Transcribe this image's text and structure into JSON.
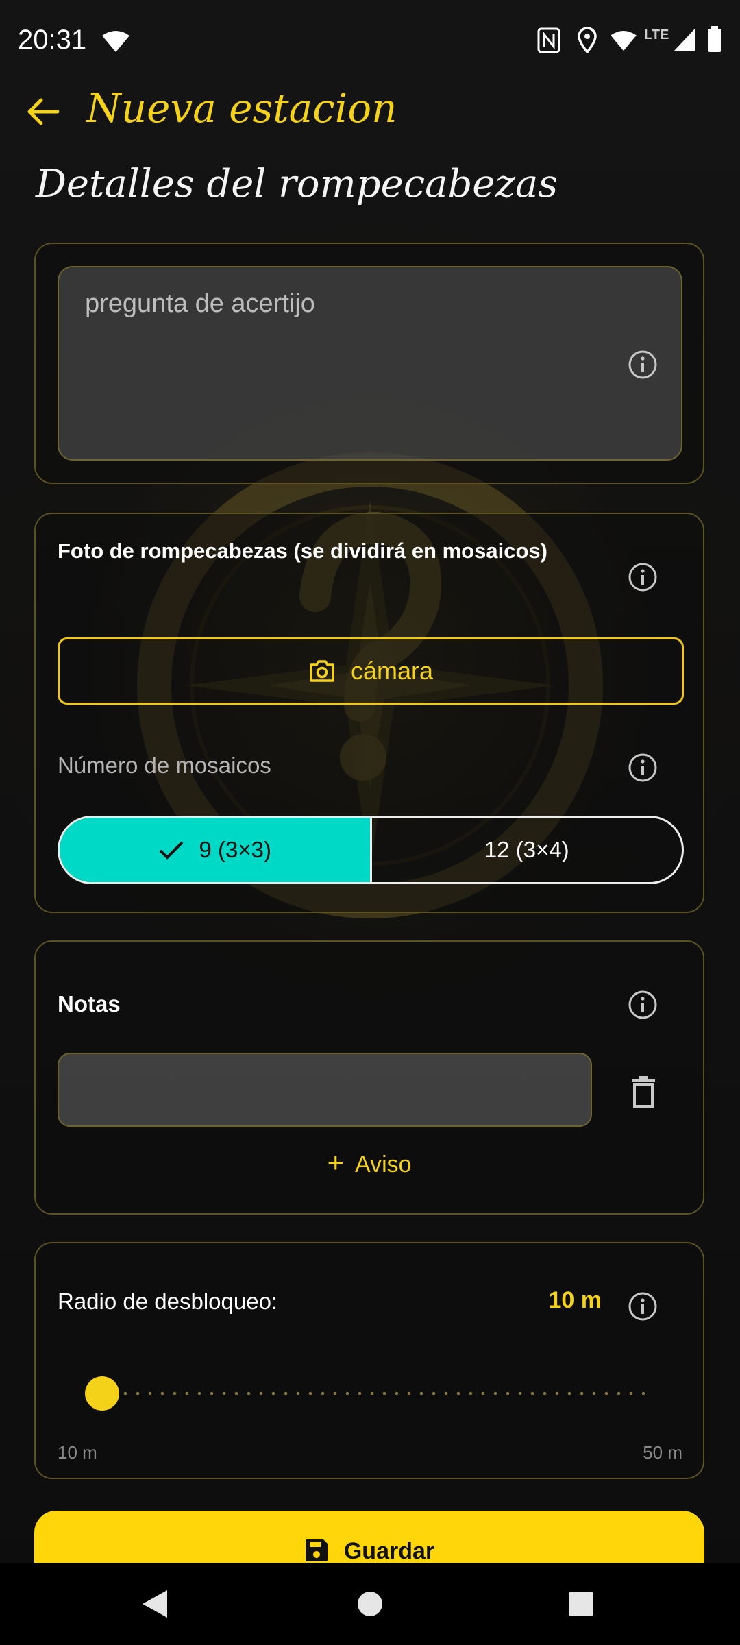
{
  "status_bar": {
    "time": "20:31",
    "network": "LTE"
  },
  "header": {
    "title": "Nueva estacion"
  },
  "section": {
    "title": "Detalles del rompecabezas"
  },
  "riddle": {
    "placeholder": "pregunta de acertijo"
  },
  "photo": {
    "label": "Foto de rompecabezas (se dividirá en mosaicos)",
    "camera_button": "cámara",
    "tiles_label": "Número de mosaicos",
    "options": [
      {
        "label": "9 (3×3)",
        "selected": true
      },
      {
        "label": "12 (3×4)",
        "selected": false
      }
    ]
  },
  "notes": {
    "title": "Notas",
    "note_value": "",
    "add_hint_button": "Aviso"
  },
  "unlock": {
    "label": "Radio de desbloqueo:",
    "value": "10 m",
    "min": "10 m",
    "max": "50 m",
    "slider_fraction": 0
  },
  "save": {
    "label": "Guardar"
  },
  "colors": {
    "accent": "#ffd60a",
    "selected": "#00d9c5",
    "background": "#101010"
  },
  "icons": [
    "back-arrow-icon",
    "info-icon",
    "camera-icon",
    "check-icon",
    "trash-icon",
    "plus-icon",
    "save-icon"
  ]
}
